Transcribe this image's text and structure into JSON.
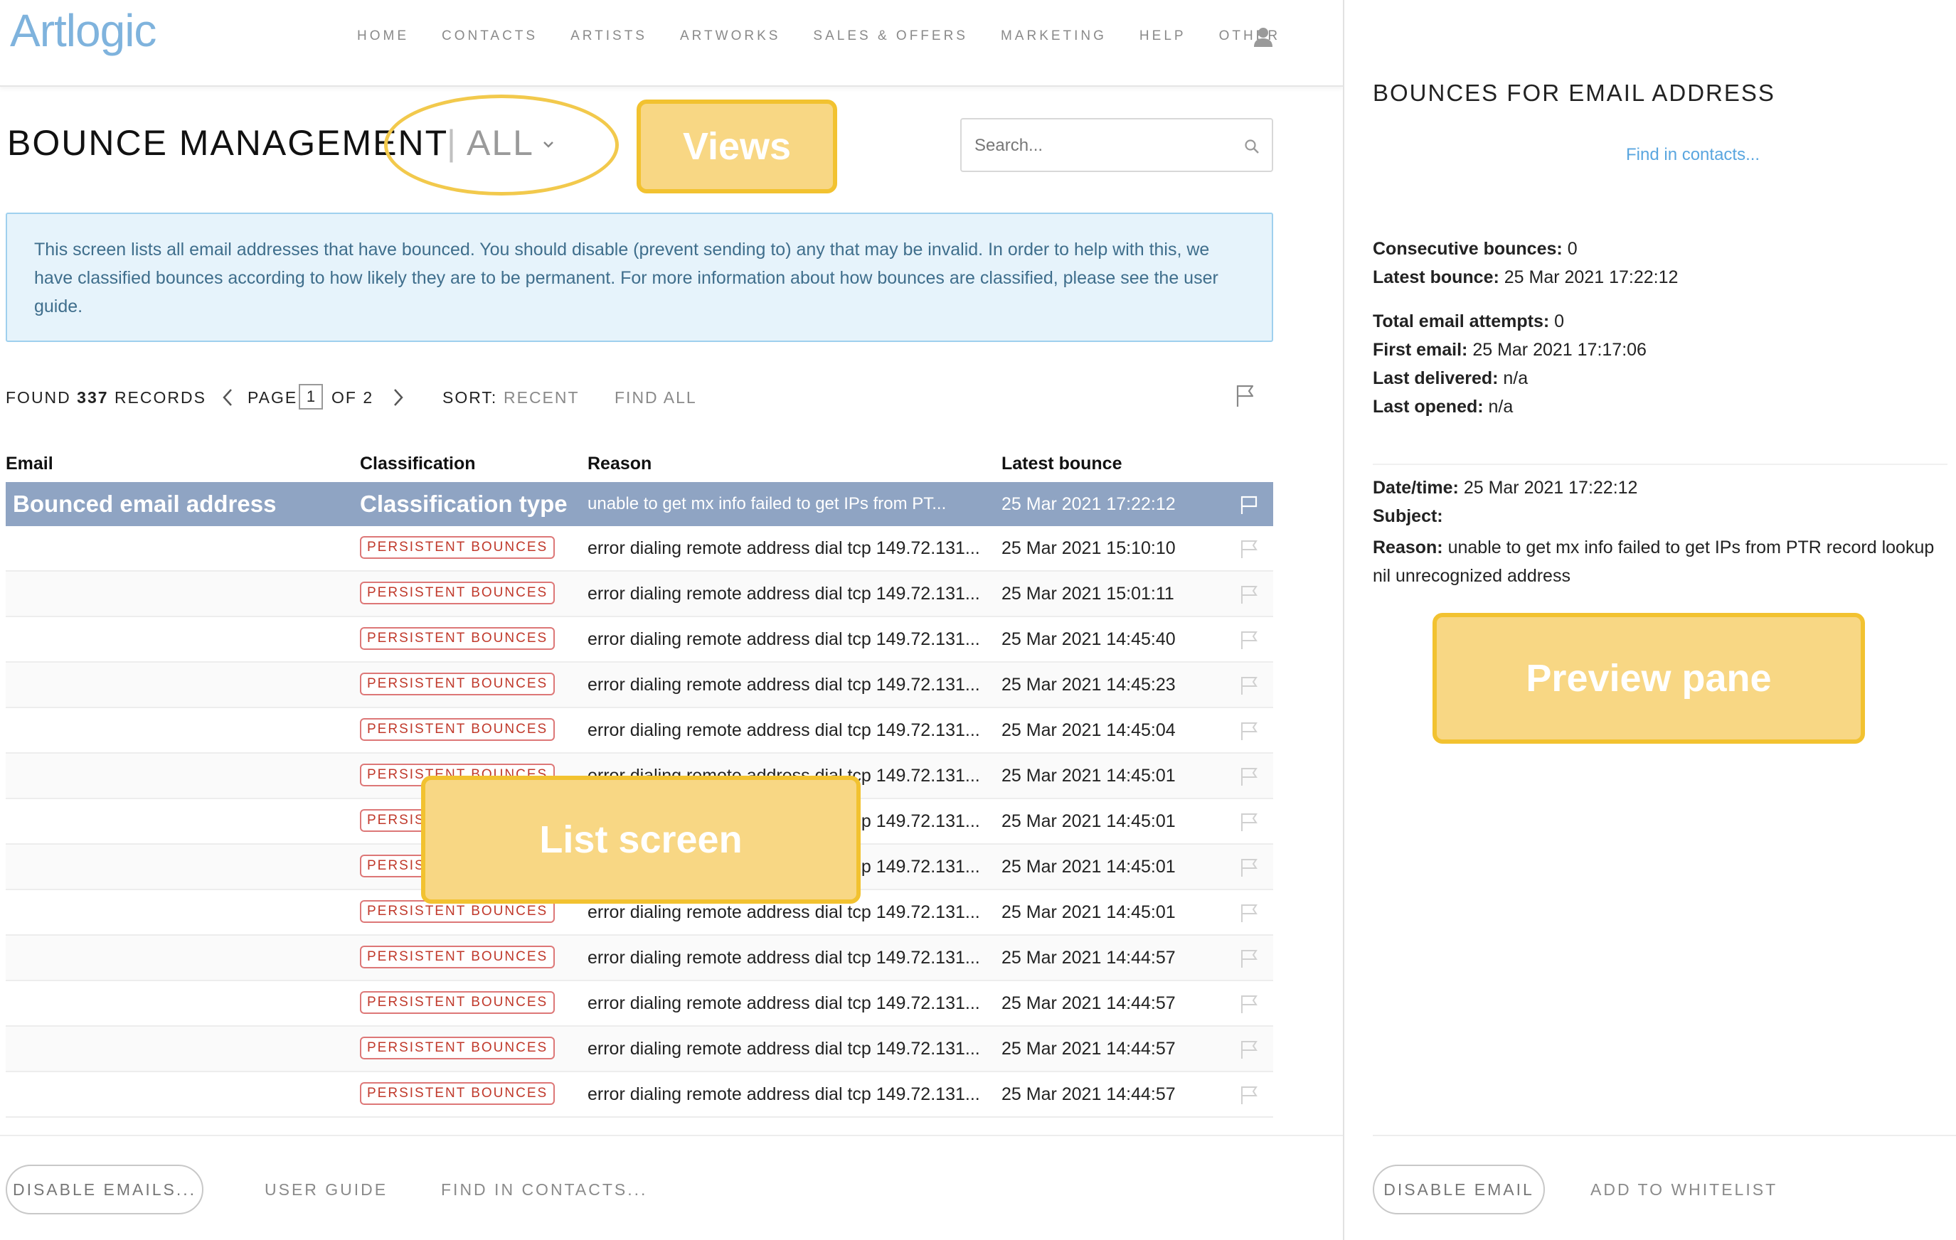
{
  "app": {
    "logo": "Artlogic"
  },
  "nav": {
    "items": [
      "HOME",
      "CONTACTS",
      "ARTISTS",
      "ARTWORKS",
      "SALES & OFFERS",
      "MARKETING",
      "HELP",
      "OTHER"
    ]
  },
  "page": {
    "title": "BOUNCE MANAGEMENT",
    "view_separator": "|",
    "view": "ALL"
  },
  "callouts": {
    "views": "Views",
    "list": "List screen",
    "preview": "Preview pane"
  },
  "search": {
    "placeholder": "Search..."
  },
  "info": {
    "text": "This screen lists all email addresses that have bounced. You should disable (prevent sending to) any that may be invalid. In order to help with this, we have classified bounces according to how likely they are to be permanent. For more information about how bounces are classified, please see the user guide."
  },
  "toolbar": {
    "found_prefix": "FOUND",
    "found_count": "337",
    "found_suffix": "RECORDS",
    "page_label": "PAGE",
    "page_current": "1",
    "page_of": "OF 2",
    "sort_label": "SORT:",
    "sort_value": "RECENT",
    "find_all": "FIND ALL"
  },
  "table": {
    "headers": {
      "email": "Email",
      "classification": "Classification",
      "reason": "Reason",
      "latest": "Latest bounce"
    },
    "selected_row": {
      "email": "Bounced email address",
      "classification": "Classification type",
      "reason": "unable to get mx info failed to get IPs from PT...",
      "latest": "25 Mar 2021 17:22:12"
    },
    "rows": [
      {
        "email": "",
        "classification": "PERSISTENT BOUNCES",
        "reason": "error dialing remote address dial tcp 149.72.131...",
        "latest": "25 Mar 2021 15:10:10"
      },
      {
        "email": "",
        "classification": "PERSISTENT BOUNCES",
        "reason": "error dialing remote address dial tcp 149.72.131...",
        "latest": "25 Mar 2021 15:01:11"
      },
      {
        "email": "",
        "classification": "PERSISTENT BOUNCES",
        "reason": "error dialing remote address dial tcp 149.72.131...",
        "latest": "25 Mar 2021 14:45:40"
      },
      {
        "email": "",
        "classification": "PERSISTENT BOUNCES",
        "reason": "error dialing remote address dial tcp 149.72.131...",
        "latest": "25 Mar 2021 14:45:23"
      },
      {
        "email": "",
        "classification": "PERSISTENT BOUNCES",
        "reason": "error dialing remote address dial tcp 149.72.131...",
        "latest": "25 Mar 2021 14:45:04"
      },
      {
        "email": "",
        "classification": "PERSISTENT BOUNCES",
        "reason": "error dialing remote address dial tcp 149.72.131...",
        "latest": "25 Mar 2021 14:45:01"
      },
      {
        "email": "",
        "classification": "PERSISTENT BOUNCES",
        "reason": "error dialing remote address dial tcp 149.72.131...",
        "latest": "25 Mar 2021 14:45:01"
      },
      {
        "email": "",
        "classification": "PERSISTENT BOUNCES",
        "reason": "error dialing remote address dial tcp 149.72.131...",
        "latest": "25 Mar 2021 14:45:01"
      },
      {
        "email": "",
        "classification": "PERSISTENT BOUNCES",
        "reason": "error dialing remote address dial tcp 149.72.131...",
        "latest": "25 Mar 2021 14:45:01"
      },
      {
        "email": "",
        "classification": "PERSISTENT BOUNCES",
        "reason": "error dialing remote address dial tcp 149.72.131...",
        "latest": "25 Mar 2021 14:44:57"
      },
      {
        "email": "",
        "classification": "PERSISTENT BOUNCES",
        "reason": "error dialing remote address dial tcp 149.72.131...",
        "latest": "25 Mar 2021 14:44:57"
      },
      {
        "email": "",
        "classification": "PERSISTENT BOUNCES",
        "reason": "error dialing remote address dial tcp 149.72.131...",
        "latest": "25 Mar 2021 14:44:57"
      },
      {
        "email": "",
        "classification": "PERSISTENT BOUNCES",
        "reason": "error dialing remote address dial tcp 149.72.131...",
        "latest": "25 Mar 2021 14:44:57"
      }
    ]
  },
  "footer": {
    "disable_emails": "DISABLE EMAILS...",
    "user_guide": "USER GUIDE",
    "find_in_contacts": "FIND IN CONTACTS..."
  },
  "preview": {
    "title": "BOUNCES FOR EMAIL ADDRESS",
    "find_link": "Find in contacts...",
    "stats": [
      {
        "label": "Consecutive bounces:",
        "value": "0"
      },
      {
        "label": "Latest bounce:",
        "value": "25 Mar 2021 17:22:12"
      },
      {
        "label": "Total email attempts:",
        "value": "0"
      },
      {
        "label": "First email:",
        "value": "25 Mar 2021 17:17:06"
      },
      {
        "label": "Last delivered:",
        "value": "n/a"
      },
      {
        "label": "Last opened:",
        "value": "n/a"
      }
    ],
    "detail": {
      "datetime_label": "Date/time:",
      "datetime_value": "25 Mar 2021 17:22:12",
      "subject_label": "Subject:",
      "subject_value": "",
      "reason_label": "Reason:",
      "reason_value": "unable to get mx info failed to get IPs from PTR record lookup nil unrecognized address"
    },
    "disable_email": "DISABLE EMAIL",
    "add_to_whitelist": "ADD TO WHITELIST"
  },
  "colors": {
    "accent_blue": "#5aa6df",
    "logo_blue": "#7fb3dd",
    "selected_row": "#8fa4c3",
    "badge_red": "#c0392b",
    "callout_yellow": "#f8d784",
    "callout_border": "#f2c230",
    "info_bg": "#e6f3fb"
  },
  "icons": {
    "user": "user-icon",
    "search": "search-icon",
    "flag": "flag-icon",
    "prev": "chevron-left-icon",
    "next": "chevron-right-icon",
    "view_dropdown": "chevron-down-icon"
  }
}
